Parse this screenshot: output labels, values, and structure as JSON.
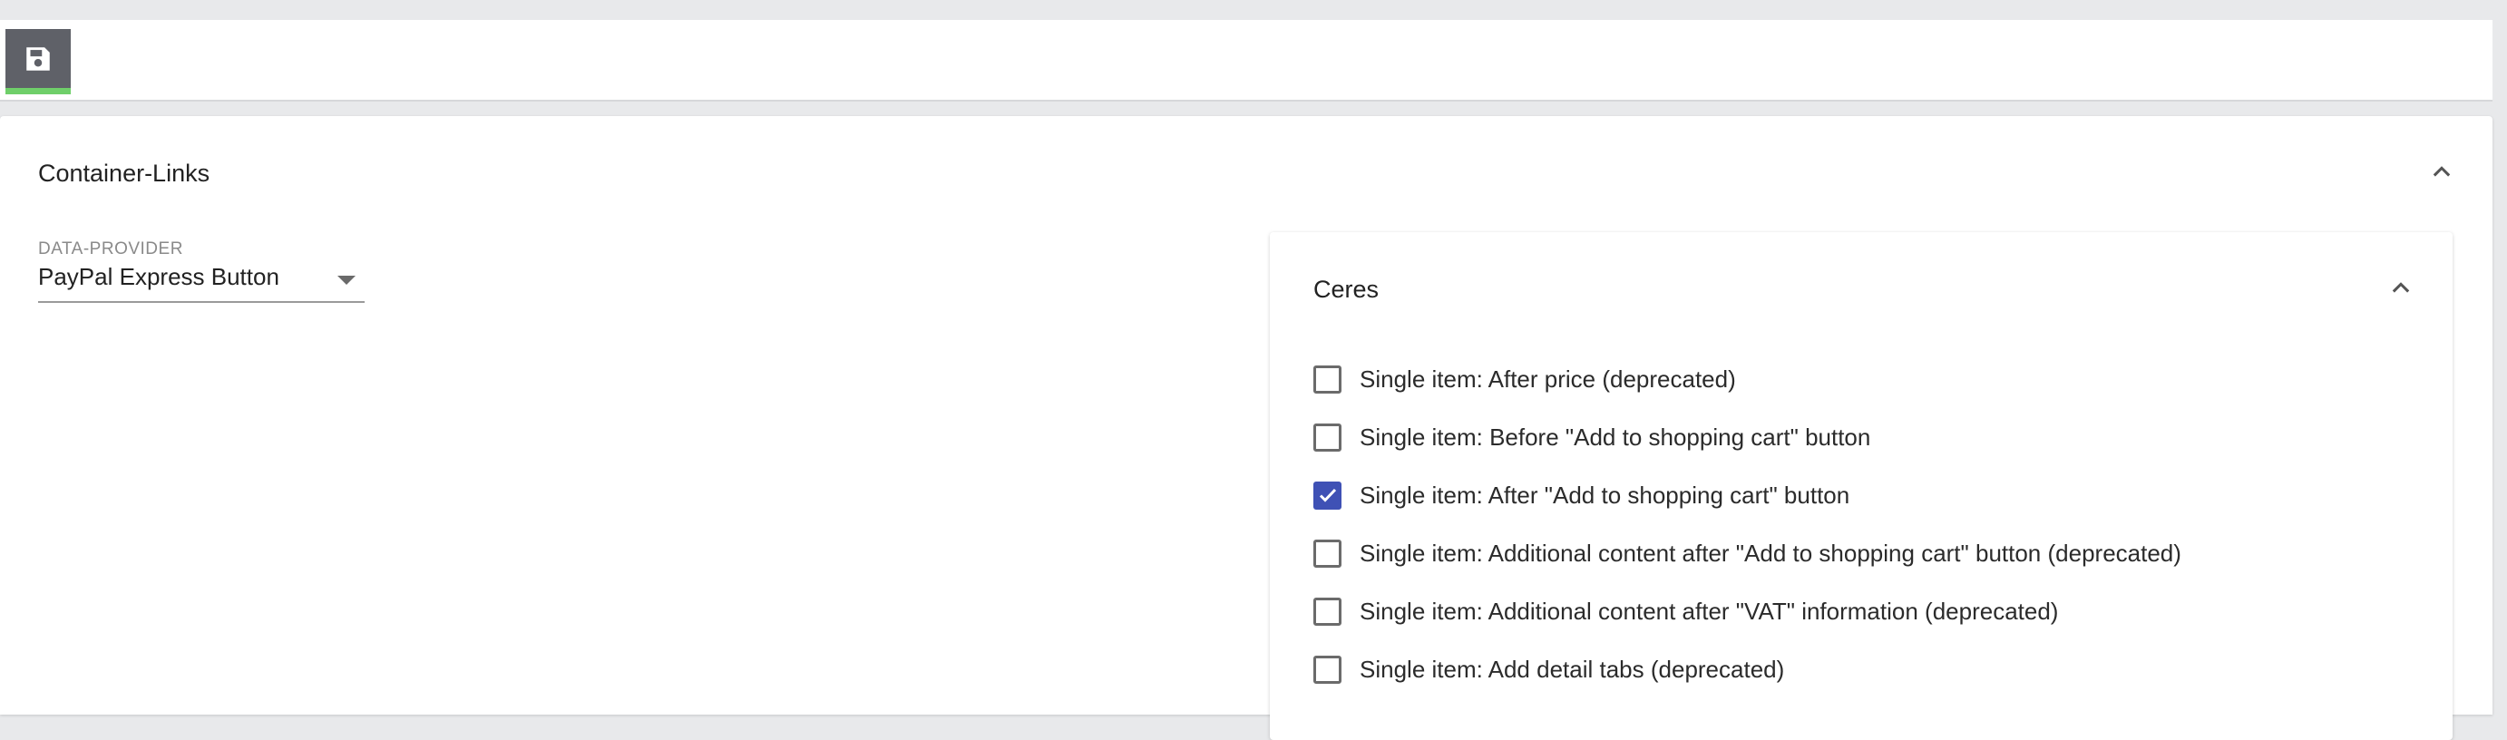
{
  "toolbar": {
    "save_icon": "floppy-disk-icon",
    "save_accent": "#6fcf6a"
  },
  "panel": {
    "title": "Container-Links",
    "collapse_icon": "chevron-up-icon"
  },
  "data_provider": {
    "label": "DATA-PROVIDER",
    "value": "PayPal Express Button"
  },
  "ceres": {
    "title": "Ceres",
    "collapse_icon": "chevron-up-icon",
    "accent": "#3f51b5",
    "items": [
      {
        "label": "Single item: After price (deprecated)",
        "checked": false
      },
      {
        "label": "Single item: Before \"Add to shopping cart\" button",
        "checked": false
      },
      {
        "label": "Single item: After \"Add to shopping cart\" button",
        "checked": true
      },
      {
        "label": "Single item: Additional content after \"Add to shopping cart\" button (deprecated)",
        "checked": false
      },
      {
        "label": "Single item: Additional content after \"VAT\" information (deprecated)",
        "checked": false
      },
      {
        "label": "Single item: Add detail tabs (deprecated)",
        "checked": false
      }
    ]
  }
}
